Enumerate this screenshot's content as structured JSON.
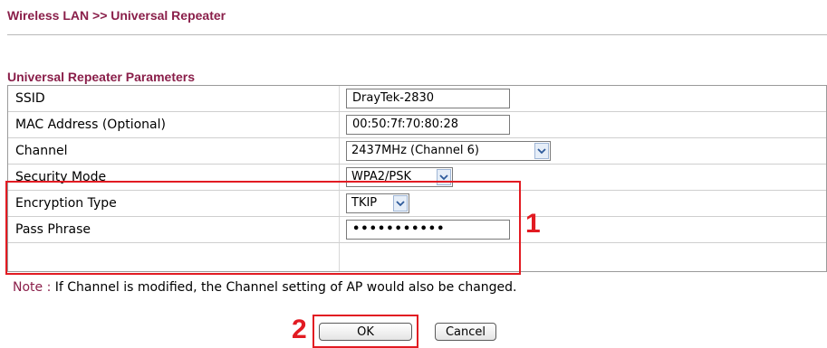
{
  "header": {
    "title": "Wireless LAN >> Universal Repeater"
  },
  "section": {
    "title": "Universal Repeater Parameters"
  },
  "fields": {
    "ssid": {
      "label": "SSID",
      "value": "DrayTek-2830"
    },
    "mac": {
      "label": "MAC Address (Optional)",
      "value": "00:50:7f:70:80:28"
    },
    "channel": {
      "label": "Channel",
      "value": "2437MHz (Channel 6)"
    },
    "security": {
      "label": "Security Mode",
      "value": "WPA2/PSK"
    },
    "encryption": {
      "label": "Encryption Type",
      "value": "TKIP"
    },
    "pass": {
      "label": "Pass Phrase",
      "value": "•••••••••••"
    }
  },
  "note": {
    "label": "Note :",
    "text": "If Channel is modified, the Channel setting of AP would also be changed."
  },
  "buttons": {
    "ok": "OK",
    "cancel": "Cancel"
  },
  "annotations": {
    "one": "1",
    "two": "2"
  },
  "colors": {
    "title": "#8a1f4a",
    "annotation": "#e21b22"
  },
  "icons": {
    "dropdown": "chevron-down-icon"
  }
}
